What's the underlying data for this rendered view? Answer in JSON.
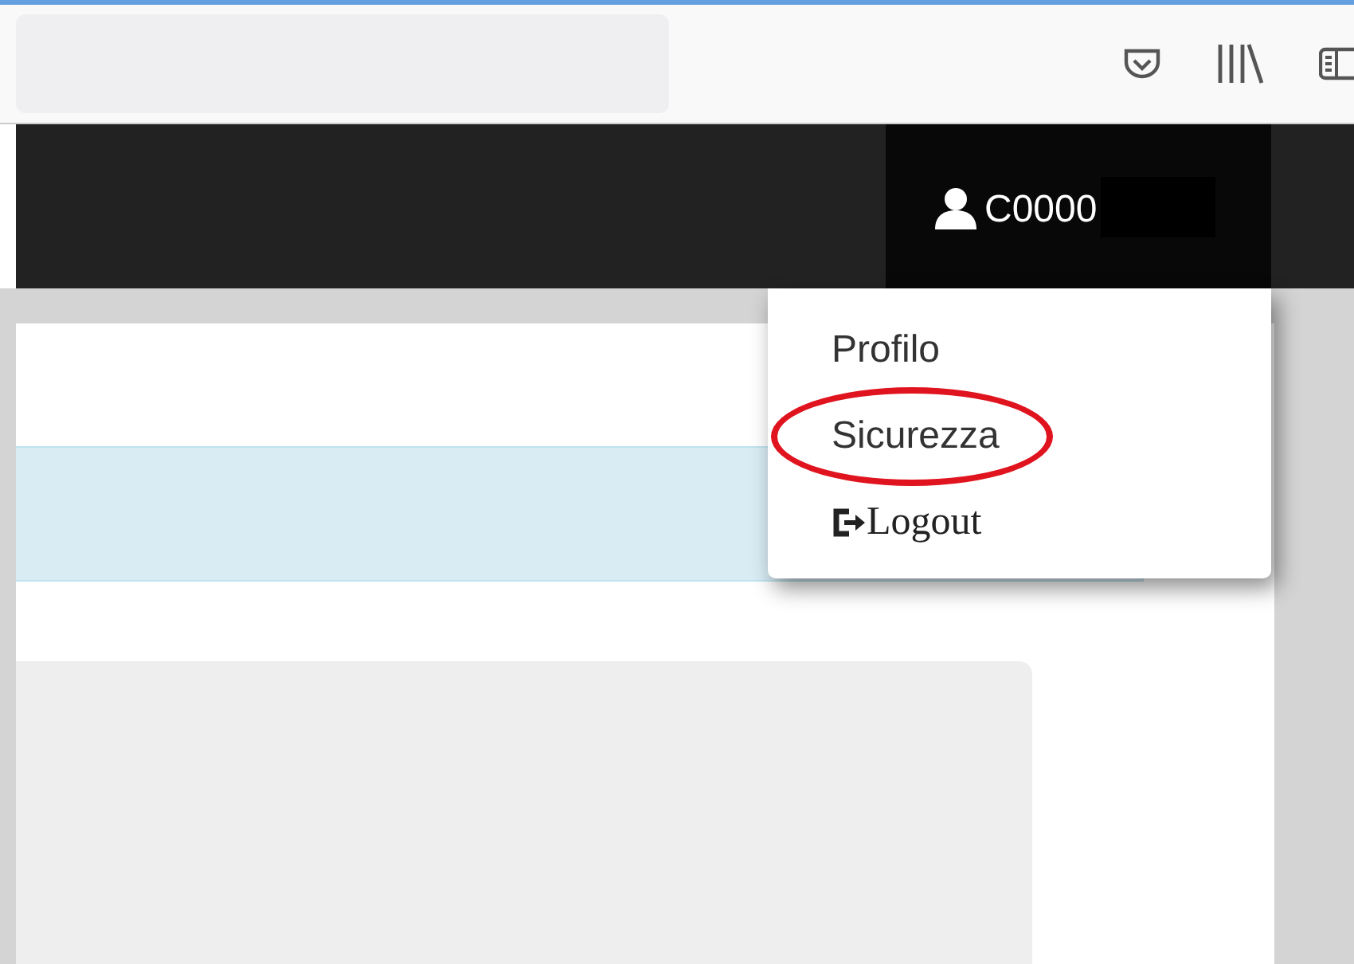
{
  "user_menu": {
    "username": "C0000",
    "redacted": true,
    "expanded": true
  },
  "dropdown": [
    {
      "label": "Profilo",
      "kind": "plain",
      "circled": false
    },
    {
      "label": "Sicurezza",
      "kind": "plain",
      "circled": true
    },
    {
      "label": "Logout",
      "kind": "logout",
      "circled": false
    }
  ]
}
